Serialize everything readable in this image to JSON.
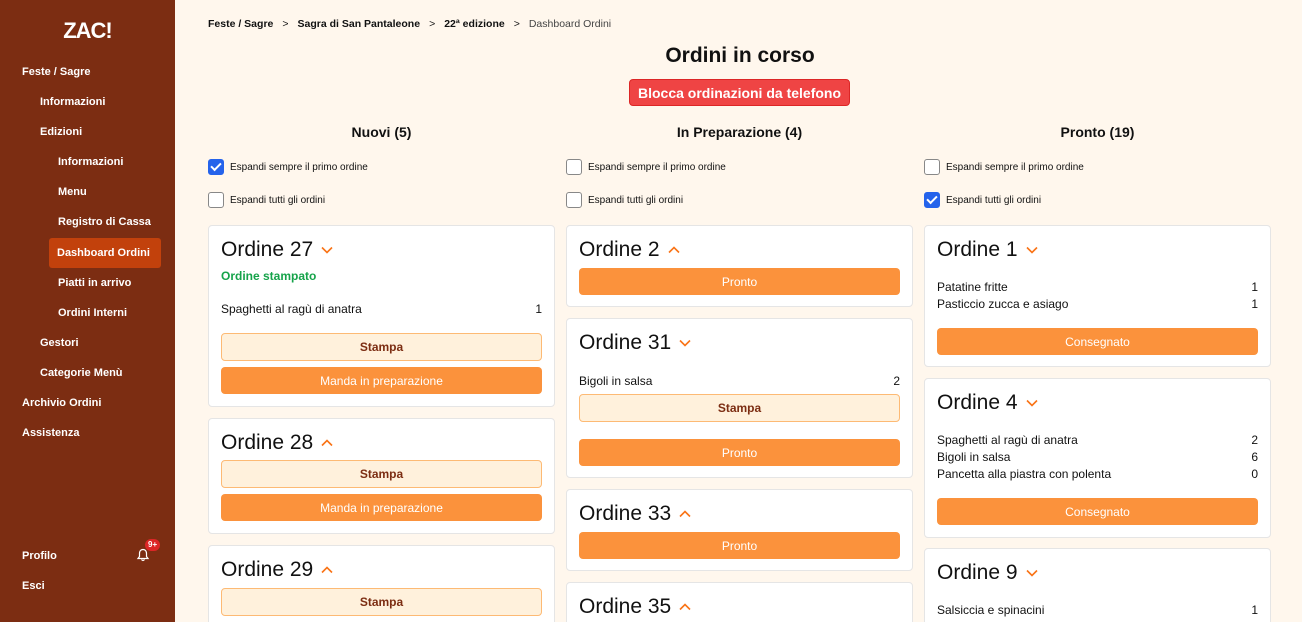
{
  "app": {
    "logo": "ZAC!"
  },
  "sidebar": {
    "items": [
      {
        "label": "Feste / Sagre"
      },
      {
        "label": "Informazioni"
      },
      {
        "label": "Edizioni"
      },
      {
        "label": "Informazioni"
      },
      {
        "label": "Menu"
      },
      {
        "label": "Registro di Cassa"
      },
      {
        "label": "Dashboard Ordini"
      },
      {
        "label": "Piatti in arrivo"
      },
      {
        "label": "Ordini Interni"
      },
      {
        "label": "Gestori"
      },
      {
        "label": "Categorie Menù"
      },
      {
        "label": "Archivio Ordini"
      },
      {
        "label": "Assistenza"
      }
    ],
    "profile": "Profilo",
    "logout": "Esci",
    "notifications_badge": "9+"
  },
  "breadcrumb": [
    "Feste / Sagre",
    "Sagra di San Pantaleone",
    "22ª edizione",
    "Dashboard Ordini"
  ],
  "header": {
    "title": "Ordini in corso",
    "block_button": "Blocca ordinazioni da telefono"
  },
  "options": {
    "expand_first": "Espandi sempre il primo ordine",
    "expand_all": "Espandi tutti gli ordini"
  },
  "buttons": {
    "print": "Stampa",
    "send_prep": "Manda in preparazione",
    "ready": "Pronto",
    "delivered": "Consegnato"
  },
  "columns": {
    "new": {
      "title": "Nuovi (5)",
      "orders": [
        {
          "title": "Ordine 27",
          "status": "Ordine stampato",
          "items": [
            {
              "name": "Spaghetti al ragù di anatra",
              "qty": "1"
            }
          ]
        },
        {
          "title": "Ordine 28"
        },
        {
          "title": "Ordine 29"
        }
      ]
    },
    "prep": {
      "title": "In Preparazione (4)",
      "orders": [
        {
          "title": "Ordine 2"
        },
        {
          "title": "Ordine 31",
          "items": [
            {
              "name": "Bigoli in salsa",
              "qty": "2"
            }
          ]
        },
        {
          "title": "Ordine 33"
        },
        {
          "title": "Ordine 35"
        }
      ]
    },
    "ready": {
      "title": "Pronto (19)",
      "orders": [
        {
          "title": "Ordine 1",
          "items": [
            {
              "name": "Patatine fritte",
              "qty": "1"
            },
            {
              "name": "Pasticcio zucca e asiago",
              "qty": "1"
            }
          ]
        },
        {
          "title": "Ordine 4",
          "items": [
            {
              "name": "Spaghetti al ragù di anatra",
              "qty": "2"
            },
            {
              "name": "Bigoli in salsa",
              "qty": "6"
            },
            {
              "name": "Pancetta alla piastra con polenta",
              "qty": "0"
            }
          ]
        },
        {
          "title": "Ordine 9",
          "items": [
            {
              "name": "Salsiccia e spinacini",
              "qty": "1"
            }
          ]
        }
      ]
    }
  },
  "colors": {
    "sidebar": "#7c2d12",
    "active": "#c2410c",
    "accent": "#fb923c",
    "danger": "#ef4444",
    "background": "#fff7ed"
  }
}
